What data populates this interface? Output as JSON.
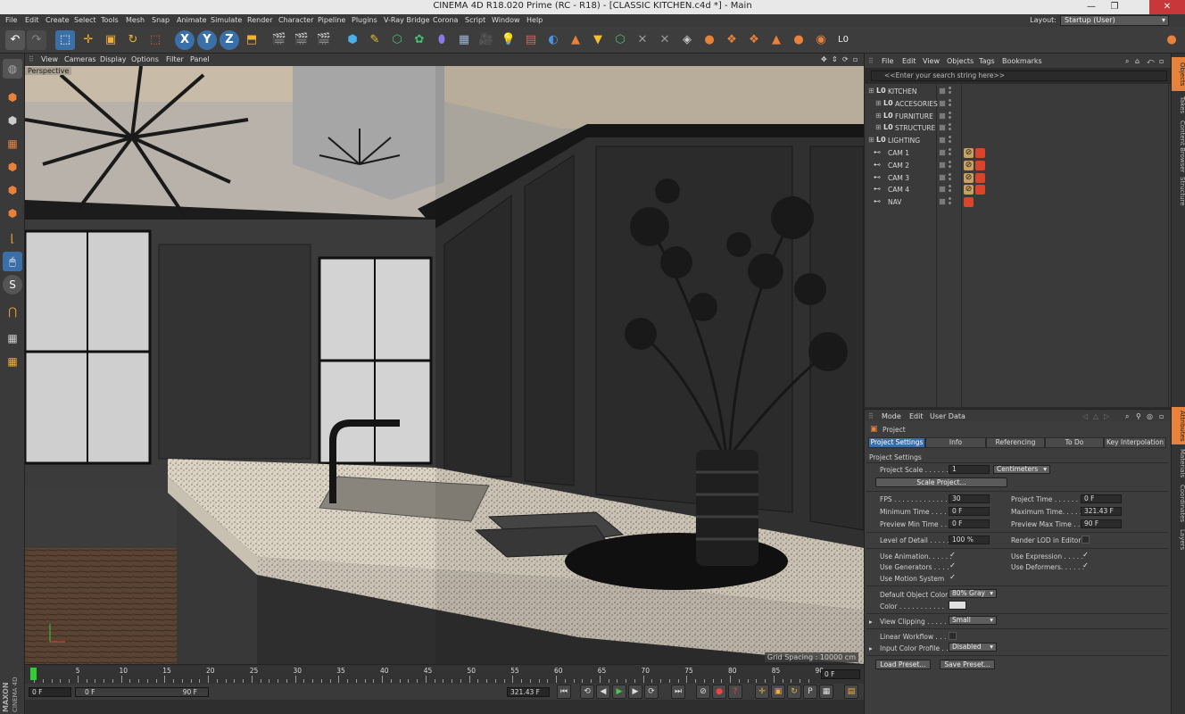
{
  "window": {
    "title": "CINEMA 4D R18.020 Prime (RC - R18) - [CLASSIC KITCHEN.c4d *] - Main",
    "minimize": "—",
    "restore": "❐",
    "close": "✕"
  },
  "menubar": {
    "items": [
      "File",
      "Edit",
      "Create",
      "Select",
      "Tools",
      "Mesh",
      "Snap",
      "Animate",
      "Simulate",
      "Render",
      "Character",
      "Pipeline",
      "Plugins",
      "V-Ray Bridge",
      "Corona",
      "Script",
      "Window",
      "Help"
    ],
    "layout_label": "Layout:",
    "layout_value": "Startup (User)"
  },
  "toolbar": {
    "axis_x": "X",
    "axis_y": "Y",
    "axis_z": "Z"
  },
  "viewport": {
    "menu": [
      "View",
      "Cameras",
      "Display",
      "Options",
      "Filter",
      "Panel"
    ],
    "label": "Perspective",
    "grid_spacing": "Grid Spacing : 10000 cm"
  },
  "timeline": {
    "ticks": [
      "0",
      "5",
      "10",
      "15",
      "20",
      "25",
      "30",
      "35",
      "40",
      "45",
      "50",
      "55",
      "60",
      "65",
      "70",
      "75",
      "80",
      "85",
      "90"
    ],
    "current_frame": "0 F",
    "start_field": "0 F",
    "range_start": "0 F",
    "range_end": "90 F",
    "end_field": "321.43 F"
  },
  "brand": {
    "line1": "MAXON",
    "line2": "CINEMA 4D"
  },
  "object_manager": {
    "menu": [
      "File",
      "Edit",
      "View",
      "Objects",
      "Tags",
      "Bookmarks"
    ],
    "search_placeholder": "<<Enter your search string here>>",
    "rows": [
      {
        "name": "KITCHEN"
      },
      {
        "name": "ACCESORIES"
      },
      {
        "name": "FURNITURE"
      },
      {
        "name": "STRUCTURE"
      },
      {
        "name": "LIGHTING"
      },
      {
        "name": "CAM 1"
      },
      {
        "name": "CAM 2"
      },
      {
        "name": "CAM 3"
      },
      {
        "name": "CAM 4"
      },
      {
        "name": "NAV"
      }
    ]
  },
  "right_tabs": [
    "Objects",
    "Takes",
    "Content Browser",
    "Structure",
    "Attributes",
    "Materials",
    "Coordinates",
    "Layers"
  ],
  "attributes": {
    "menu": [
      "Mode",
      "Edit",
      "User Data"
    ],
    "header": "Project",
    "tabs": [
      "Project Settings",
      "Info",
      "Referencing",
      "To Do",
      "Key Interpolation"
    ],
    "section": "Project Settings",
    "project_scale_label": "Project Scale . . . . . .",
    "project_scale_value": "1",
    "project_scale_unit": "Centimeters",
    "scale_button": "Scale Project...",
    "fps_label": "FPS . . . . . . . . . . . . .",
    "fps_value": "30",
    "project_time_label": "Project Time . . . . . .",
    "project_time_value": "0 F",
    "min_time_label": "Minimum Time . . . . .",
    "min_time_value": "0 F",
    "max_time_label": "Maximum Time. . . . .",
    "max_time_value": "321.43 F",
    "prev_min_label": "Preview Min Time . .",
    "prev_min_value": "0 F",
    "prev_max_label": "Preview Max Time . .",
    "prev_max_value": "90 F",
    "lod_label": "Level of Detail . . . . .",
    "lod_value": "100 %",
    "render_lod_label": "Render LOD in Editor",
    "use_animation": "Use Animation. . . . . .",
    "use_expression": "Use Expression . . . . .",
    "use_generators": "Use Generators . . . .",
    "use_deformers": "Use Deformers. . . . . .",
    "use_motion": "Use Motion System",
    "default_color_label": "Default Object Color",
    "default_color_value": "80% Gray",
    "color_label": "Color . . . . . . . . . . .",
    "view_clipping_label": "View Clipping . . . . . .",
    "view_clipping_value": "Small",
    "linear_workflow_label": "Linear Workflow . . . .",
    "input_color_label": "Input Color Profile . .",
    "input_color_value": "Disabled",
    "load_preset": "Load Preset...",
    "save_preset": "Save Preset..."
  },
  "colors": {
    "accent": "#3b6fa8",
    "orange": "#e8823a",
    "tag_red": "#d9442a"
  }
}
